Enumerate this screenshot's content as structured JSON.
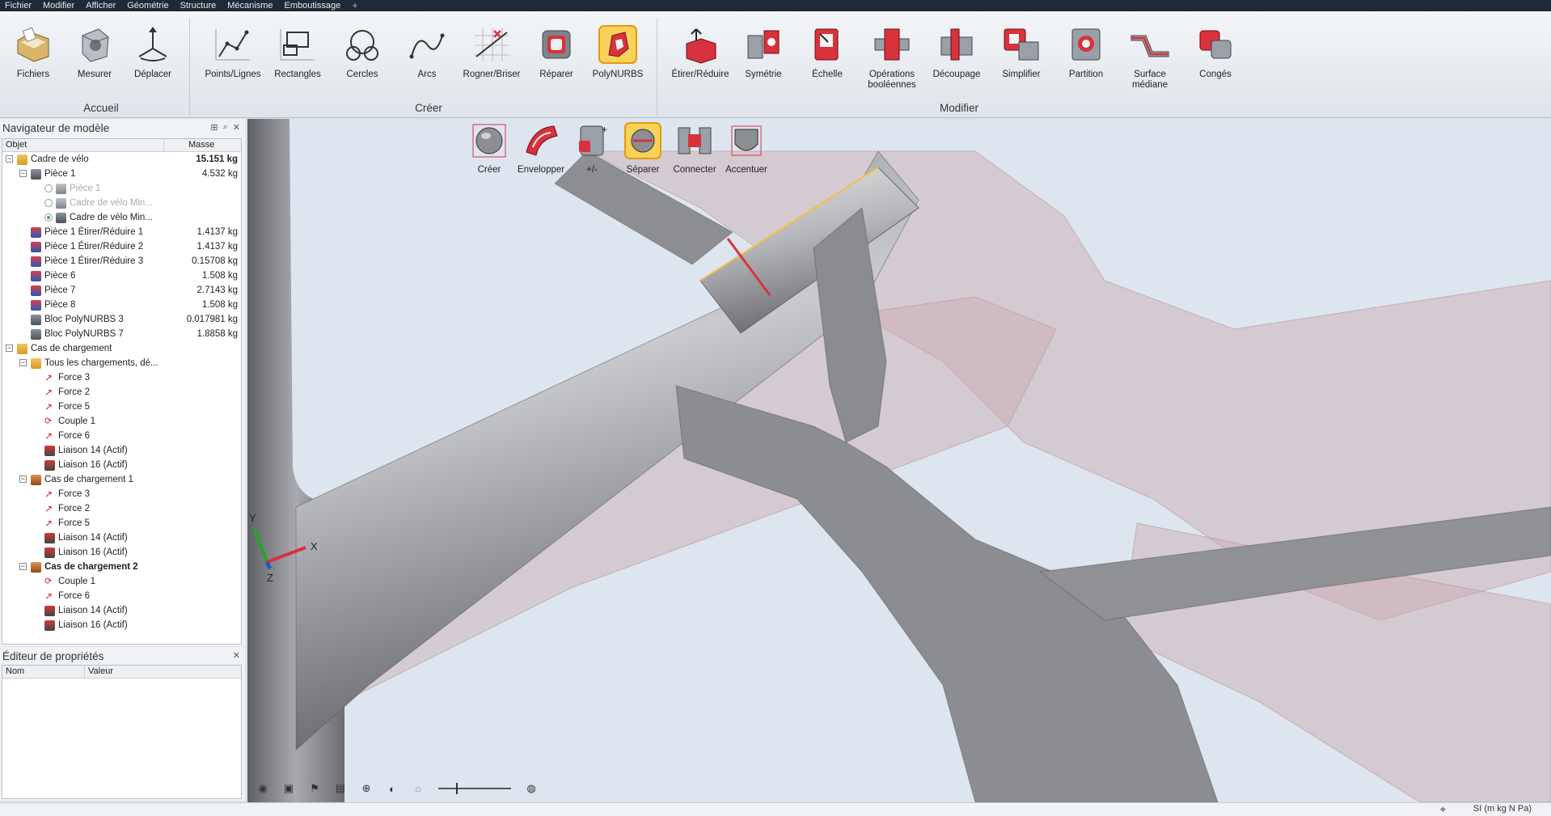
{
  "menu": [
    "Fichier",
    "Modifier",
    "Afficher",
    "Géométrie",
    "Structure",
    "Mécanisme",
    "Emboutissage"
  ],
  "menu_active_index": 3,
  "ribbon": {
    "accueil": {
      "label": "Accueil",
      "tools": [
        "Fichiers",
        "Mesurer",
        "Déplacer"
      ]
    },
    "creer": {
      "label": "Créer",
      "tools": [
        "Points/Lignes",
        "Rectangles",
        "Cercles",
        "Arcs",
        "Rogner/Briser",
        "Réparer",
        "PolyNURBS"
      ]
    },
    "modifier": {
      "label": "Modifier",
      "tools": [
        "Étirer/Réduire",
        "Symétrie",
        "Échelle",
        "Opérations booléennes",
        "Découpage",
        "Simplifier",
        "Partition",
        "Surface médiane",
        "Congés"
      ]
    }
  },
  "polynurbs_tools": [
    "Créer",
    "Envelopper",
    "+/-",
    "Séparer",
    "Connecter",
    "Accentuer"
  ],
  "navigator": {
    "title": "Navigateur de modèle",
    "col_object": "Objet",
    "col_mass": "Masse",
    "rows": [
      {
        "level": 0,
        "exp": "−",
        "icon": "ic-folder",
        "text": "Cadre de vélo",
        "mass": "15.151 kg",
        "massBold": true
      },
      {
        "level": 1,
        "exp": "−",
        "icon": "ic-part",
        "text": "Pièce 1",
        "mass": "4.532 kg"
      },
      {
        "level": 2,
        "radio": "off",
        "icon": "ic-grey",
        "text": "Pièce 1",
        "dim": true
      },
      {
        "level": 2,
        "radio": "off",
        "icon": "ic-grey",
        "text": "Cadre de vélo Min...",
        "dim": true
      },
      {
        "level": 2,
        "radio": "on",
        "icon": "ic-part",
        "text": "Cadre de vélo Min..."
      },
      {
        "level": 1,
        "icon": "ic-red",
        "text": "Pièce 1 Étirer/Réduire 1",
        "mass": "1.4137 kg"
      },
      {
        "level": 1,
        "icon": "ic-red",
        "text": "Pièce 1 Étirer/Réduire 2",
        "mass": "1.4137 kg"
      },
      {
        "level": 1,
        "icon": "ic-red",
        "text": "Pièce 1 Étirer/Réduire 3",
        "mass": "0.15708 kg"
      },
      {
        "level": 1,
        "icon": "ic-red",
        "text": "Pièce 6",
        "mass": "1.508 kg"
      },
      {
        "level": 1,
        "icon": "ic-red",
        "text": "Pièce 7",
        "mass": "2.7143 kg"
      },
      {
        "level": 1,
        "icon": "ic-red",
        "text": "Pièce 8",
        "mass": "1.508 kg"
      },
      {
        "level": 1,
        "icon": "ic-part",
        "text": "Bloc PolyNURBS 3",
        "mass": "0.017981 kg"
      },
      {
        "level": 1,
        "icon": "ic-part",
        "text": "Bloc PolyNURBS 7",
        "mass": "1.8858 kg"
      },
      {
        "level": 0,
        "exp": "−",
        "icon": "ic-folder",
        "text": "Cas de chargement"
      },
      {
        "level": 1,
        "exp": "−",
        "icon": "ic-folder",
        "text": "Tous les chargements, dé..."
      },
      {
        "level": 2,
        "icon": "ic-force",
        "glyph": "↗",
        "text": "Force 3"
      },
      {
        "level": 2,
        "icon": "ic-force",
        "glyph": "↗",
        "text": "Force 2"
      },
      {
        "level": 2,
        "icon": "ic-force",
        "glyph": "↗",
        "text": "Force 5"
      },
      {
        "level": 2,
        "icon": "ic-couple",
        "glyph": "⟳",
        "text": "Couple 1"
      },
      {
        "level": 2,
        "icon": "ic-force",
        "glyph": "↗",
        "text": "Force 6"
      },
      {
        "level": 2,
        "icon": "ic-liaison",
        "text": "Liaison 14 (Actif)"
      },
      {
        "level": 2,
        "icon": "ic-liaison",
        "text": "Liaison 16 (Actif)"
      },
      {
        "level": 1,
        "exp": "−",
        "icon": "ic-loads",
        "text": "Cas de chargement 1"
      },
      {
        "level": 2,
        "icon": "ic-force",
        "glyph": "↗",
        "text": "Force 3"
      },
      {
        "level": 2,
        "icon": "ic-force",
        "glyph": "↗",
        "text": "Force 2"
      },
      {
        "level": 2,
        "icon": "ic-force",
        "glyph": "↗",
        "text": "Force 5"
      },
      {
        "level": 2,
        "icon": "ic-liaison",
        "text": "Liaison 14 (Actif)"
      },
      {
        "level": 2,
        "icon": "ic-liaison",
        "text": "Liaison 16 (Actif)"
      },
      {
        "level": 1,
        "exp": "−",
        "icon": "ic-loads",
        "text": "Cas de chargement 2",
        "bold": true
      },
      {
        "level": 2,
        "icon": "ic-couple",
        "glyph": "⟳",
        "text": "Couple 1"
      },
      {
        "level": 2,
        "icon": "ic-force",
        "glyph": "↗",
        "text": "Force 6"
      },
      {
        "level": 2,
        "icon": "ic-liaison",
        "text": "Liaison 14 (Actif)"
      },
      {
        "level": 2,
        "icon": "ic-liaison",
        "text": "Liaison 16 (Actif)"
      }
    ]
  },
  "properties": {
    "title": "Éditeur de propriétés",
    "col_name": "Nom",
    "col_value": "Valeur"
  },
  "axes": {
    "x": "X",
    "y": "Y",
    "z": "Z"
  },
  "status": {
    "units": "SI (m kg N Pa)"
  },
  "colors": {
    "accent": "#f0c040",
    "red": "#d8323c",
    "frame": "#8a8c90",
    "designSpace": "#c9a9ad"
  }
}
